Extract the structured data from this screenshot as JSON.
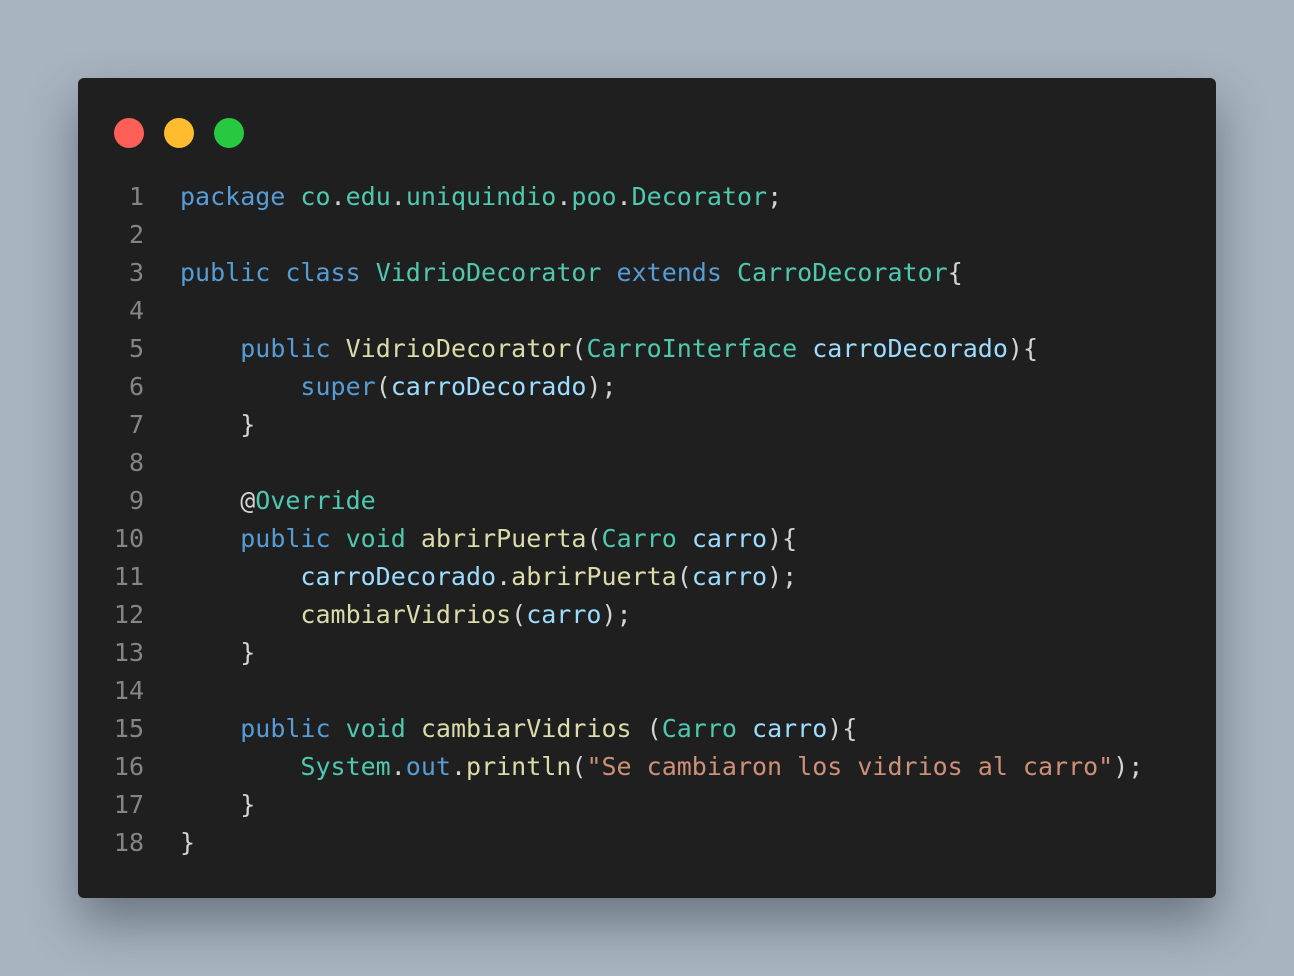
{
  "window": {
    "buttons": [
      "close",
      "minimize",
      "maximize"
    ]
  },
  "colors": {
    "background": "#a8b4c0",
    "window": "#1f1f1f",
    "close": "#ff5f57",
    "minimize": "#febc2e",
    "maximize": "#28c840",
    "keyword": "#569cd6",
    "type": "#4ec9b0",
    "function": "#dcdcaa",
    "variable": "#9cdcfe",
    "string": "#ce9178",
    "text": "#d4d4d4",
    "line_number": "#858585"
  },
  "code": {
    "language": "java",
    "lines": [
      {
        "n": "1",
        "tokens": [
          [
            "kw",
            "package"
          ],
          [
            "pu",
            " "
          ],
          [
            "ty",
            "co"
          ],
          [
            "pu",
            "."
          ],
          [
            "ty",
            "edu"
          ],
          [
            "pu",
            "."
          ],
          [
            "ty",
            "uniquindio"
          ],
          [
            "pu",
            "."
          ],
          [
            "ty",
            "poo"
          ],
          [
            "pu",
            "."
          ],
          [
            "ty",
            "Decorator"
          ],
          [
            "pu",
            ";"
          ]
        ]
      },
      {
        "n": "2",
        "tokens": []
      },
      {
        "n": "3",
        "tokens": [
          [
            "kw",
            "public"
          ],
          [
            "pu",
            " "
          ],
          [
            "kw",
            "class"
          ],
          [
            "pu",
            " "
          ],
          [
            "ty",
            "VidrioDecorator"
          ],
          [
            "pu",
            " "
          ],
          [
            "kw",
            "extends"
          ],
          [
            "pu",
            " "
          ],
          [
            "ty",
            "CarroDecorator"
          ],
          [
            "pu",
            "{"
          ]
        ]
      },
      {
        "n": "4",
        "tokens": []
      },
      {
        "n": "5",
        "tokens": [
          [
            "pu",
            "    "
          ],
          [
            "kw",
            "public"
          ],
          [
            "pu",
            " "
          ],
          [
            "fn",
            "VidrioDecorator"
          ],
          [
            "pu",
            "("
          ],
          [
            "ty",
            "CarroInterface"
          ],
          [
            "pu",
            " "
          ],
          [
            "va",
            "carroDecorado"
          ],
          [
            "pu",
            "){"
          ]
        ]
      },
      {
        "n": "6",
        "tokens": [
          [
            "pu",
            "        "
          ],
          [
            "kw",
            "super"
          ],
          [
            "pu",
            "("
          ],
          [
            "va",
            "carroDecorado"
          ],
          [
            "pu",
            ");"
          ]
        ]
      },
      {
        "n": "7",
        "tokens": [
          [
            "pu",
            "    }"
          ]
        ]
      },
      {
        "n": "8",
        "tokens": []
      },
      {
        "n": "9",
        "tokens": [
          [
            "pu",
            "    @"
          ],
          [
            "ty",
            "Override"
          ]
        ]
      },
      {
        "n": "10",
        "tokens": [
          [
            "pu",
            "    "
          ],
          [
            "kw",
            "public"
          ],
          [
            "pu",
            " "
          ],
          [
            "ty",
            "void"
          ],
          [
            "pu",
            " "
          ],
          [
            "fn",
            "abrirPuerta"
          ],
          [
            "pu",
            "("
          ],
          [
            "ty",
            "Carro"
          ],
          [
            "pu",
            " "
          ],
          [
            "va",
            "carro"
          ],
          [
            "pu",
            "){"
          ]
        ]
      },
      {
        "n": "11",
        "tokens": [
          [
            "pu",
            "        "
          ],
          [
            "va",
            "carroDecorado"
          ],
          [
            "pu",
            "."
          ],
          [
            "fn",
            "abrirPuerta"
          ],
          [
            "pu",
            "("
          ],
          [
            "va",
            "carro"
          ],
          [
            "pu",
            ");"
          ]
        ]
      },
      {
        "n": "12",
        "tokens": [
          [
            "pu",
            "        "
          ],
          [
            "fn",
            "cambiarVidrios"
          ],
          [
            "pu",
            "("
          ],
          [
            "va",
            "carro"
          ],
          [
            "pu",
            ");"
          ]
        ]
      },
      {
        "n": "13",
        "tokens": [
          [
            "pu",
            "    }"
          ]
        ]
      },
      {
        "n": "14",
        "tokens": []
      },
      {
        "n": "15",
        "tokens": [
          [
            "pu",
            "    "
          ],
          [
            "kw",
            "public"
          ],
          [
            "pu",
            " "
          ],
          [
            "ty",
            "void"
          ],
          [
            "pu",
            " "
          ],
          [
            "fn",
            "cambiarVidrios"
          ],
          [
            "pu",
            " ("
          ],
          [
            "ty",
            "Carro"
          ],
          [
            "pu",
            " "
          ],
          [
            "va",
            "carro"
          ],
          [
            "pu",
            "){"
          ]
        ]
      },
      {
        "n": "16",
        "tokens": [
          [
            "pu",
            "        "
          ],
          [
            "ty",
            "System"
          ],
          [
            "pu",
            "."
          ],
          [
            "kw",
            "out"
          ],
          [
            "pu",
            "."
          ],
          [
            "fn",
            "println"
          ],
          [
            "pu",
            "("
          ],
          [
            "st",
            "\"Se cambiaron los vidrios al carro\""
          ],
          [
            "pu",
            ");"
          ]
        ]
      },
      {
        "n": "17",
        "tokens": [
          [
            "pu",
            "    }"
          ]
        ]
      },
      {
        "n": "18",
        "tokens": [
          [
            "pu",
            "}"
          ]
        ]
      }
    ]
  }
}
